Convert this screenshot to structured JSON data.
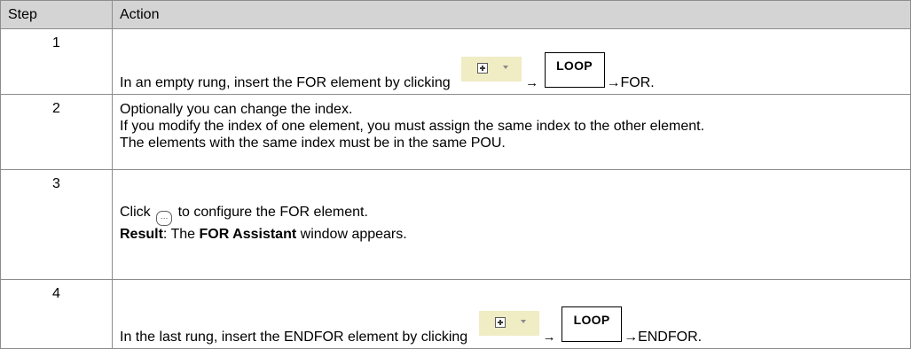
{
  "table": {
    "headers": {
      "step": "Step",
      "action": "Action"
    },
    "rows": [
      {
        "step": "1",
        "action_prefix": "In an empty rung, insert the FOR element by clicking",
        "arrow1": "→",
        "loop_label": "LOOP",
        "action_suffix": "→FOR."
      },
      {
        "step": "2",
        "lines": [
          "Optionally you can change the index.",
          "If you modify the index of one element, you must assign the same index to the other element.",
          "The elements with the same index must be in the same POU."
        ]
      },
      {
        "step": "3",
        "click_label": "Click",
        "ellipsis_glyph": "…",
        "click_suffix": "to configure the FOR element.",
        "result_label": "Result",
        "result_colon": ": The ",
        "result_bold": "FOR Assistant",
        "result_suffix": " window appears."
      },
      {
        "step": "4",
        "action_prefix": "In the last rung, insert the ENDFOR element by clicking",
        "arrow1": "→",
        "loop_label": "LOOP",
        "action_suffix": "→ENDFOR."
      }
    ]
  },
  "colors": {
    "header_bg": "#d4d4d4",
    "border": "#8c8c8c",
    "insert_button_bg": "#f0ecc4"
  },
  "icons": {
    "insert": "insert-box-icon",
    "dropdown": "chevron-down-icon",
    "ellipsis": "ellipsis-button-icon"
  }
}
